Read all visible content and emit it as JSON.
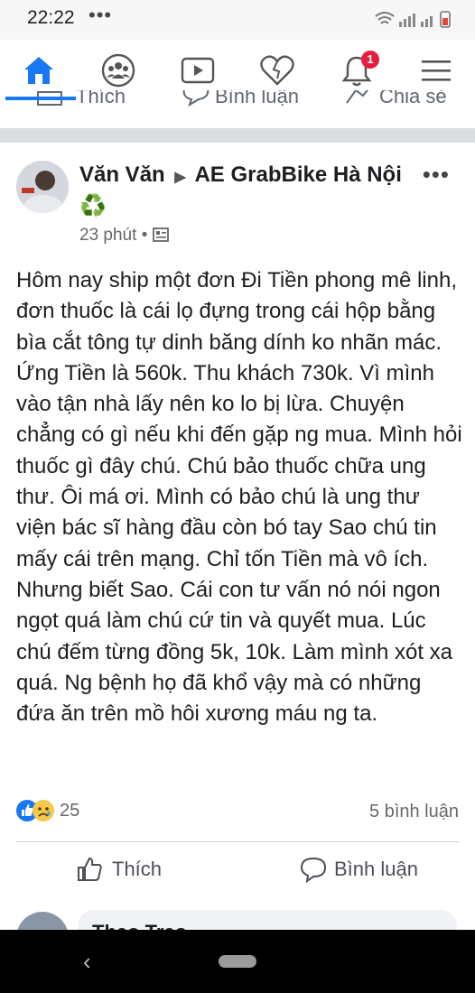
{
  "status_bar": {
    "time": "22:22",
    "dots": "•••",
    "notification_count": "1"
  },
  "nav": {
    "items": [
      "home-icon",
      "groups-icon",
      "watch-icon",
      "dating-icon",
      "bell-icon",
      "menu-icon"
    ]
  },
  "previous_post_actions": {
    "like": "Thích",
    "comment": "Bình luận",
    "share": "Chia sẻ"
  },
  "post": {
    "author": "Văn Văn",
    "group": "AE GrabBike Hà Nội ♻️",
    "time": "23 phút",
    "body": "Hôm nay ship một đơn Đi Tiền phong mê linh,  đơn thuốc là cái lọ đựng trong cái hộp bằng bìa cắt tông tự dinh băng dính ko nhãn mác. Ứng Tiền là 560k.  Thu khách 730k.  Vì mình vào tận nhà lấy nên ko lo bị lừa.  Chuyện chẳng có gì nếu khi đến gặp ng mua.  Mình hỏi thuốc gì đây chú.  Chú bảo thuốc chữa ung thư.  Ôi má ơi.  Mình có bảo chú là ung thư viện bác sĩ hàng đầu còn bó tay Sao chú tin mấy cái trên mạng.  Chỉ tốn Tiền mà vô ích.  Nhưng biết Sao.  Cái con tư vấn nó nói ngon ngọt quá làm chú cứ tin và quyết mua. Lúc chú đếm từng đồng 5k, 10k.  Làm mình xót xa quá.  Ng bệnh họ đã khổ vậy mà có những đứa ăn trên mồ hôi xương máu ng ta.",
    "reaction_count": "25",
    "comment_count": "5 bình luận",
    "like_label": "Thích",
    "comment_label": "Bình luận"
  },
  "next_comment": {
    "name": "Thao Trao"
  },
  "colors": {
    "brand": "#1877f2",
    "badge": "#e41e3f",
    "divider": "#dadde1"
  }
}
